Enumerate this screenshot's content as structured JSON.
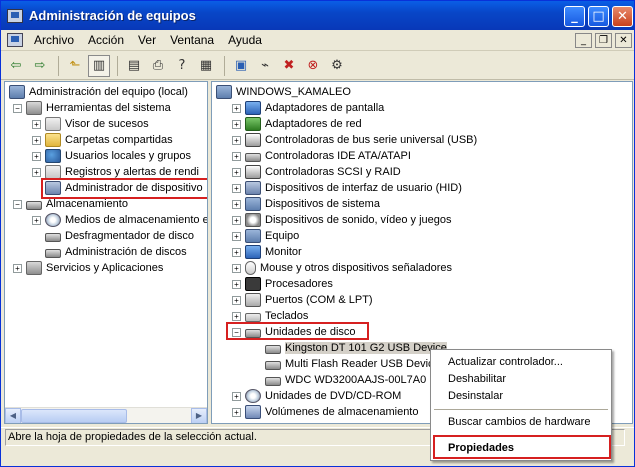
{
  "window": {
    "title": "Administración de equipos",
    "controls": [
      "minimize",
      "maximize",
      "close"
    ]
  },
  "menubar": {
    "items": [
      "Archivo",
      "Acción",
      "Ver",
      "Ventana",
      "Ayuda"
    ]
  },
  "toolbar": {
    "icons": [
      "back-arrow-icon",
      "forward-arrow-icon",
      "up-folder-icon",
      "show-tree-icon",
      "properties-icon",
      "print-icon",
      "help-icon",
      "refresh-icon",
      "computer-icon",
      "scan-icon",
      "uninstall-icon",
      "disable-icon",
      "update-driver-icon"
    ]
  },
  "left_tree": {
    "items": [
      {
        "label": "Administración del equipo (local)",
        "level": 0,
        "expander": "-",
        "icon": "computer-management-icon"
      },
      {
        "label": "Herramientas del sistema",
        "level": 1,
        "expander": "-",
        "icon": "tools-icon"
      },
      {
        "label": "Visor de sucesos",
        "level": 2,
        "expander": "+",
        "icon": "event-viewer-icon"
      },
      {
        "label": "Carpetas compartidas",
        "level": 2,
        "expander": "+",
        "icon": "shared-folder-icon"
      },
      {
        "label": "Usuarios locales y grupos",
        "level": 2,
        "expander": "+",
        "icon": "users-icon"
      },
      {
        "label": "Registros y alertas de rendi",
        "level": 2,
        "expander": "+",
        "icon": "performance-icon"
      },
      {
        "label": "Administrador de dispositivo",
        "level": 2,
        "expander": "",
        "icon": "device-manager-icon"
      },
      {
        "label": "Almacenamiento",
        "level": 1,
        "expander": "-",
        "icon": "storage-icon"
      },
      {
        "label": "Medios de almacenamiento e",
        "level": 2,
        "expander": "+",
        "icon": "removable-storage-icon"
      },
      {
        "label": "Desfragmentador de disco",
        "level": 2,
        "expander": "",
        "icon": "defrag-icon"
      },
      {
        "label": "Administración de discos",
        "level": 2,
        "expander": "",
        "icon": "disk-management-icon"
      },
      {
        "label": "Servicios y Aplicaciones",
        "level": 1,
        "expander": "+",
        "icon": "services-icon"
      }
    ]
  },
  "right_tree": {
    "root": "WINDOWS_KAMALEO",
    "categories": [
      {
        "label": "Adaptadores de pantalla",
        "icon": "display-adapter-icon"
      },
      {
        "label": "Adaptadores de red",
        "icon": "network-adapter-icon"
      },
      {
        "label": "Controladoras de bus serie universal (USB)",
        "icon": "usb-icon"
      },
      {
        "label": "Controladoras IDE ATA/ATAPI",
        "icon": "ide-icon"
      },
      {
        "label": "Controladoras SCSI y RAID",
        "icon": "scsi-icon"
      },
      {
        "label": "Dispositivos de interfaz de usuario (HID)",
        "icon": "hid-icon"
      },
      {
        "label": "Dispositivos de sistema",
        "icon": "system-device-icon"
      },
      {
        "label": "Dispositivos de sonido, vídeo y juegos",
        "icon": "sound-icon"
      },
      {
        "label": "Equipo",
        "icon": "computer-icon"
      },
      {
        "label": "Monitor",
        "icon": "monitor-icon"
      },
      {
        "label": "Mouse y otros dispositivos señaladores",
        "icon": "mouse-icon"
      },
      {
        "label": "Procesadores",
        "icon": "processor-icon"
      },
      {
        "label": "Puertos (COM & LPT)",
        "icon": "port-icon"
      },
      {
        "label": "Teclados",
        "icon": "keyboard-icon"
      },
      {
        "label": "Unidades de disco",
        "icon": "disk-drive-icon",
        "expanded": true
      },
      {
        "label": "Unidades de DVD/CD-ROM",
        "icon": "cdrom-icon"
      },
      {
        "label": "Volúmenes de almacenamiento",
        "icon": "volume-icon"
      }
    ],
    "disk_children": [
      "Kingston DT 101 G2 USB Device",
      "Multi Flash Reader USB Device",
      "WDC WD3200AAJS-00L7A0"
    ]
  },
  "context_menu": {
    "items": [
      "Actualizar controlador...",
      "Deshabilitar",
      "Desinstalar",
      "Buscar cambios de hardware",
      "Propiedades"
    ],
    "default_item": "Propiedades"
  },
  "statusbar": {
    "text": "Abre la hoja de propiedades de la selección actual."
  },
  "colors": {
    "titlebar": "#0a5ee6",
    "highlight": "#d62020",
    "window_bg": "#ece9d8"
  }
}
